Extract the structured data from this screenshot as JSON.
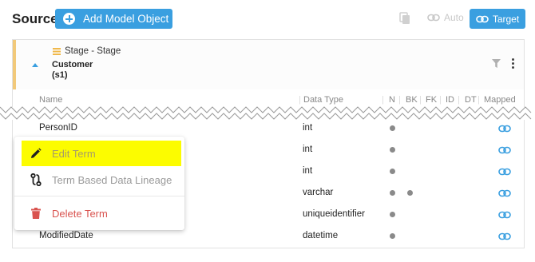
{
  "header": {
    "title": "Source",
    "add_button_label": "Add Model Object",
    "auto_label": "Auto",
    "target_label": "Target"
  },
  "card": {
    "stage_label": "Stage - Stage",
    "table_name_line1": "Customer",
    "table_name_line2": "(s1)"
  },
  "columns": {
    "name": "Name",
    "data_type": "Data Type",
    "n": "N",
    "bk": "BK",
    "fk": "FK",
    "id": "ID",
    "dt": "DT",
    "mapped": "Mapped"
  },
  "rows": [
    {
      "name": "PersonID",
      "data_type": "int",
      "n": true,
      "bk": false
    },
    {
      "name": "",
      "data_type": "int",
      "n": true,
      "bk": false
    },
    {
      "name": "",
      "data_type": "int",
      "n": true,
      "bk": false
    },
    {
      "name": "",
      "data_type": "varchar",
      "n": true,
      "bk": true
    },
    {
      "name": "",
      "data_type": "uniqueidentifier",
      "n": true,
      "bk": false
    },
    {
      "name": "ModifiedDate",
      "data_type": "datetime",
      "n": true,
      "bk": false
    }
  ],
  "context_menu": {
    "items": [
      {
        "label": "Edit Term",
        "icon": "pencil-icon"
      },
      {
        "label": "Term Based Data Lineage",
        "icon": "lineage-icon"
      },
      {
        "label": "Delete Term",
        "icon": "trash-icon"
      }
    ]
  },
  "colors": {
    "accent": "#3a9fe0",
    "highlight": "#fcfc00",
    "stage_border": "#f2c97a",
    "delete": "#d9534f"
  }
}
